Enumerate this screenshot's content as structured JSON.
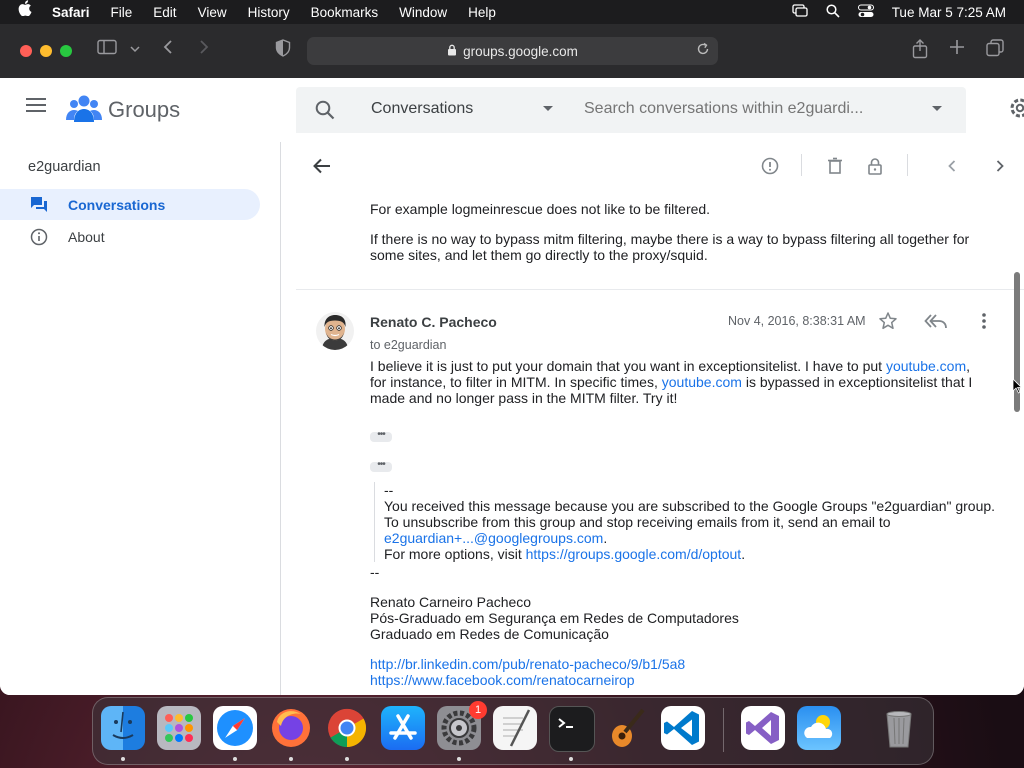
{
  "menubar": {
    "app": "Safari",
    "items": [
      "File",
      "Edit",
      "View",
      "History",
      "Bookmarks",
      "Window",
      "Help"
    ],
    "datetime": "Tue Mar 5  7:25 AM"
  },
  "browser": {
    "url": "groups.google.com"
  },
  "header": {
    "product": "Groups",
    "search_scope": "Conversations",
    "search_placeholder": "Search conversations within e2guardi..."
  },
  "sidebar": {
    "group_name": "e2guardian",
    "items": [
      {
        "label": "Conversations",
        "active": true,
        "icon": "conversations-icon"
      },
      {
        "label": "About",
        "active": false,
        "icon": "info-icon"
      }
    ]
  },
  "thread": {
    "prev_message": {
      "line1": "For example logmeinrescue does not like to be filtered.",
      "para2": "If there is no way to bypass mitm filtering, maybe there is a way to bypass filtering all together for some sites, and let them go directly to the proxy/squid."
    },
    "message": {
      "sender": "Renato C. Pacheco",
      "to": "to e2guardian",
      "date": "Nov 4, 2016, 8:38:31 AM",
      "body": {
        "p1_a": "I believe it is just to put your domain that you want in exceptionsitelist. I have to put ",
        "p1_link1": "youtube.com",
        "p1_b": ", for instance, to filter in MITM. In specific times, ",
        "p1_link2": "youtube.com",
        "p1_c": " is bypassed in exceptionsitelist that I made and no longer pass in the MITM filter. Try it!"
      },
      "quoted": {
        "sep": "--",
        "line1": "You received this message because you are subscribed to the Google Groups \"e2guardian\" group.",
        "line2": "To unsubscribe from this group and stop receiving emails from it, send an email to",
        "email_link": "e2guardian+...@googlegroups.com",
        "email_after": ".",
        "line3_a": "For more options, visit ",
        "optout_link": "https://groups.google.com/d/optout",
        "line3_b": "."
      },
      "sig_sep": "--",
      "signature": [
        "Renato Carneiro Pacheco",
        "Pós-Graduado em Segurança em Redes de Computadores",
        "Graduado em Redes de Comunicação"
      ],
      "links": [
        "http://br.linkedin.com/pub/renato-pacheco/9/b1/5a8",
        "https://www.facebook.com/renatocarneirop"
      ]
    }
  },
  "dock": {
    "badge": "1",
    "apps": [
      "finder",
      "launchpad",
      "safari",
      "firefox",
      "chrome",
      "app-store",
      "system-settings",
      "textedit",
      "terminal",
      "garageband",
      "vscode",
      "visual-studio",
      "weather",
      "trash"
    ]
  },
  "colors": {
    "accent": "#1a73e8",
    "active_nav_bg": "#e8f0fe",
    "active_nav_text": "#1967d2"
  }
}
